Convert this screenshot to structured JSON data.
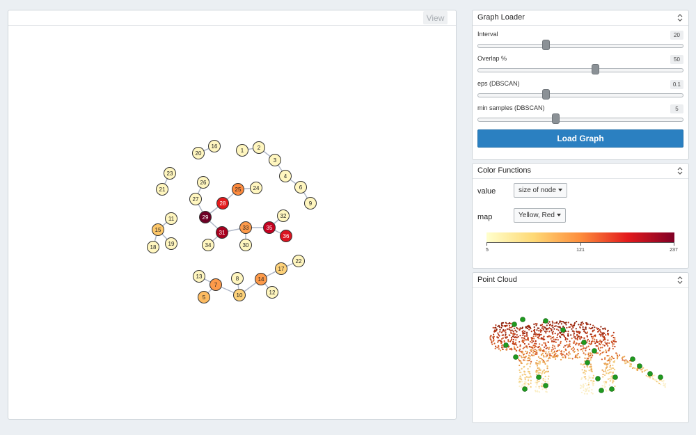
{
  "graph_panel": {
    "view_button_label": "View",
    "nodes": [
      {
        "id": "1",
        "fill": "#fff6bf"
      },
      {
        "id": "2",
        "fill": "#fff6bf"
      },
      {
        "id": "3",
        "fill": "#fff6bf"
      },
      {
        "id": "4",
        "fill": "#fff6bf"
      },
      {
        "id": "5",
        "fill": "#fdbb61"
      },
      {
        "id": "6",
        "fill": "#fff6bf"
      },
      {
        "id": "7",
        "fill": "#fd9a4a"
      },
      {
        "id": "8",
        "fill": "#fff6bf"
      },
      {
        "id": "9",
        "fill": "#fff6bf"
      },
      {
        "id": "10",
        "fill": "#fed27a"
      },
      {
        "id": "11",
        "fill": "#fff6bf"
      },
      {
        "id": "12",
        "fill": "#fff6bf"
      },
      {
        "id": "13",
        "fill": "#fff6bf"
      },
      {
        "id": "14",
        "fill": "#fd9a4a"
      },
      {
        "id": "15",
        "fill": "#fdc76a"
      },
      {
        "id": "16",
        "fill": "#fff6bf"
      },
      {
        "id": "17",
        "fill": "#fed27a"
      },
      {
        "id": "18",
        "fill": "#fff6bf"
      },
      {
        "id": "19",
        "fill": "#fff6bf"
      },
      {
        "id": "20",
        "fill": "#fff6bf"
      },
      {
        "id": "21",
        "fill": "#fff6bf"
      },
      {
        "id": "22",
        "fill": "#fff6bf"
      },
      {
        "id": "23",
        "fill": "#fff6bf"
      },
      {
        "id": "24",
        "fill": "#fff6bf"
      },
      {
        "id": "25",
        "fill": "#fc8a3e"
      },
      {
        "id": "26",
        "fill": "#fff6bf"
      },
      {
        "id": "27",
        "fill": "#fff6bf"
      },
      {
        "id": "28",
        "fill": "#e31a1c"
      },
      {
        "id": "29",
        "fill": "#6e0026"
      },
      {
        "id": "30",
        "fill": "#fff6bf"
      },
      {
        "id": "31",
        "fill": "#a8001f"
      },
      {
        "id": "32",
        "fill": "#fff6bf"
      },
      {
        "id": "33",
        "fill": "#fd9a4a"
      },
      {
        "id": "34",
        "fill": "#fff6bf"
      },
      {
        "id": "35",
        "fill": "#c4001f"
      },
      {
        "id": "36",
        "fill": "#da1521"
      }
    ],
    "edges": [
      [
        "1",
        "2"
      ],
      [
        "2",
        "3"
      ],
      [
        "3",
        "4"
      ],
      [
        "4",
        "6"
      ],
      [
        "6",
        "9"
      ],
      [
        "16",
        "20"
      ],
      [
        "21",
        "23"
      ],
      [
        "26",
        "27"
      ],
      [
        "27",
        "29"
      ],
      [
        "28",
        "29"
      ],
      [
        "28",
        "25"
      ],
      [
        "25",
        "24"
      ],
      [
        "29",
        "31"
      ],
      [
        "31",
        "34"
      ],
      [
        "31",
        "33"
      ],
      [
        "33",
        "30"
      ],
      [
        "33",
        "35"
      ],
      [
        "35",
        "32"
      ],
      [
        "35",
        "36"
      ],
      [
        "11",
        "15"
      ],
      [
        "15",
        "18"
      ],
      [
        "15",
        "19"
      ],
      [
        "13",
        "7"
      ],
      [
        "7",
        "5"
      ],
      [
        "7",
        "10"
      ],
      [
        "8",
        "10"
      ],
      [
        "10",
        "14"
      ],
      [
        "14",
        "12"
      ],
      [
        "14",
        "17"
      ],
      [
        "17",
        "22"
      ]
    ]
  },
  "graph_loader": {
    "title": "Graph Loader",
    "sliders": [
      {
        "label": "Interval",
        "value": "20",
        "fraction": 0.33
      },
      {
        "label": "Overlap %",
        "value": "50",
        "fraction": 0.57
      },
      {
        "label": "eps (DBSCAN)",
        "value": "0.1",
        "fraction": 0.33
      },
      {
        "label": "min samples (DBSCAN)",
        "value": "5",
        "fraction": 0.38
      }
    ],
    "load_button_label": "Load Graph"
  },
  "color_functions": {
    "title": "Color Functions",
    "value_label": "value",
    "value_selected": "size of node",
    "map_label": "map",
    "map_selected": "Yellow, Red",
    "colorbar_ticks": [
      "5",
      "121",
      "237"
    ],
    "colorbar_colors": [
      "#ffffcc",
      "#fed976",
      "#fd8d3c",
      "#e31a1c",
      "#800026"
    ]
  },
  "point_cloud": {
    "title": "Point Cloud",
    "point_colors": [
      "#fbefc8",
      "#f3c979",
      "#e9a14f",
      "#d8612a",
      "#b83414",
      "#8a1f0a"
    ],
    "marker_color": "#1f9a1f"
  }
}
